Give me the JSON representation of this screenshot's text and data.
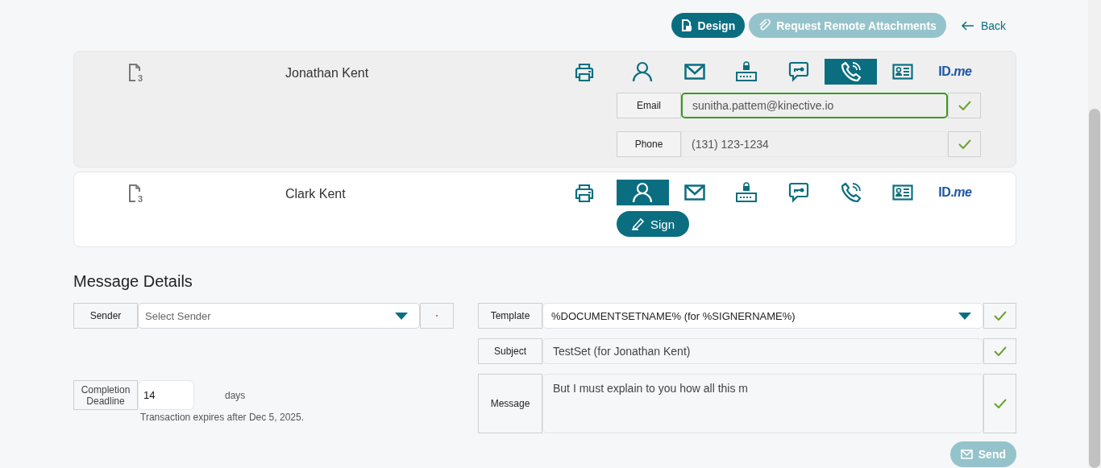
{
  "toolbar": {
    "buttons": [
      {
        "kind": "design",
        "label": "Design",
        "disabled": false
      },
      {
        "kind": "attach",
        "label": "Request Remote Attachments",
        "disabled": true
      }
    ],
    "back": {
      "label": "Back"
    }
  },
  "signers": [
    {
      "name": "Jonathan Kent",
      "doc_count": "3",
      "selected": true,
      "methods": [
        {
          "kind": "person",
          "selected": false
        },
        {
          "kind": "email",
          "selected": false
        },
        {
          "kind": "keypad",
          "selected": false
        },
        {
          "kind": "chat",
          "selected": false
        },
        {
          "kind": "phone",
          "selected": true
        },
        {
          "kind": "idcard",
          "selected": false
        },
        {
          "kind": "idme",
          "label": "ID.*me*",
          "selected": false
        }
      ],
      "fields": [
        {
          "label": "Email",
          "value": "sunitha.pattem@kinective.io",
          "focused": true,
          "valid": true
        },
        {
          "label": "Phone",
          "value": "(131) 123-1234",
          "focused": false,
          "valid": true
        }
      ]
    },
    {
      "name": "Clark Kent",
      "doc_count": "3",
      "selected": false,
      "methods": [
        {
          "kind": "person",
          "selected": true
        },
        {
          "kind": "email",
          "selected": false
        },
        {
          "kind": "keypad",
          "selected": false
        },
        {
          "kind": "chat",
          "selected": false
        },
        {
          "kind": "phone",
          "selected": false
        },
        {
          "kind": "idcard",
          "selected": false
        },
        {
          "kind": "idme",
          "label": "ID.*me*",
          "selected": false
        }
      ],
      "sign_button": {
        "label": "Sign"
      }
    }
  ],
  "message_details": {
    "title": "Message Details",
    "sender": {
      "label": "Sender",
      "placeholder": "Select Sender",
      "required": true
    },
    "deadline": {
      "label": "Completion Deadline",
      "value": "14",
      "unit": "days",
      "note": "Transaction expires after Dec 5, 2025."
    },
    "template": {
      "label": "Template",
      "value": "%DOCUMENTSETNAME% (for %SIGNERNAME%)",
      "valid": true
    },
    "subject": {
      "label": "Subject",
      "value": "TestSet (for Jonathan Kent)",
      "valid": true
    },
    "message": {
      "label": "Message",
      "value": "But I must explain to you how all this m",
      "valid": true
    },
    "send_button": {
      "label": "Send",
      "disabled": true
    }
  }
}
